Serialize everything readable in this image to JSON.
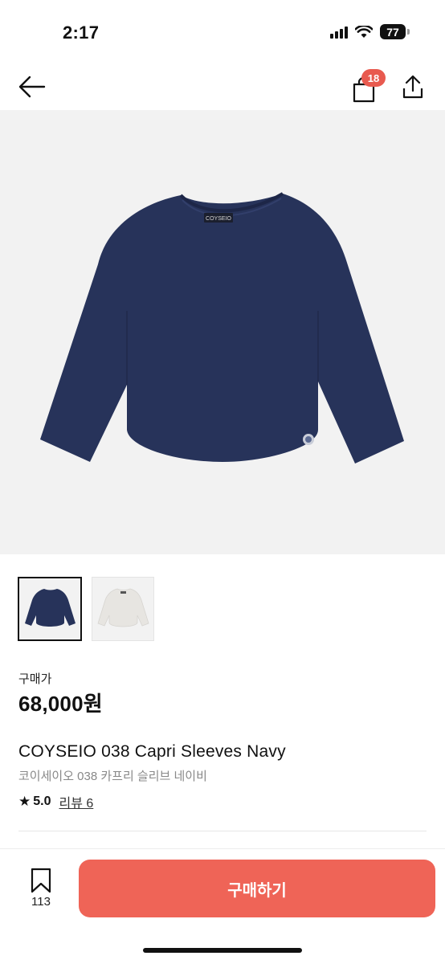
{
  "status_bar": {
    "time": "2:17",
    "battery": "77"
  },
  "header": {
    "back_icon": "arrow-left-icon",
    "bag_icon": "shopping-bag-icon",
    "bag_count": "18",
    "share_icon": "share-icon"
  },
  "product": {
    "images": [
      {
        "name": "navy-long-sleeve-tee",
        "color": "#27335a",
        "selected": true
      },
      {
        "name": "white-long-sleeve-tee",
        "color": "#efedea",
        "selected": false
      }
    ],
    "hero_label": "COYSEIO",
    "price_label": "구매가",
    "price": "68,000원",
    "title_en": "COYSEIO 038 Capri Sleeves Navy",
    "title_ko": "코이세이오 038 카프리 슬리브 네이비",
    "rating": "5.0",
    "reviews": "리뷰 6"
  },
  "bottom_bar": {
    "wish_icon": "bookmark-icon",
    "wish_count": "113",
    "buy_label": "구매하기"
  },
  "colors": {
    "accent": "#ef6457",
    "badge": "#e85a4f",
    "hero_bg": "#f2f2f2",
    "navy": "#27335a"
  }
}
